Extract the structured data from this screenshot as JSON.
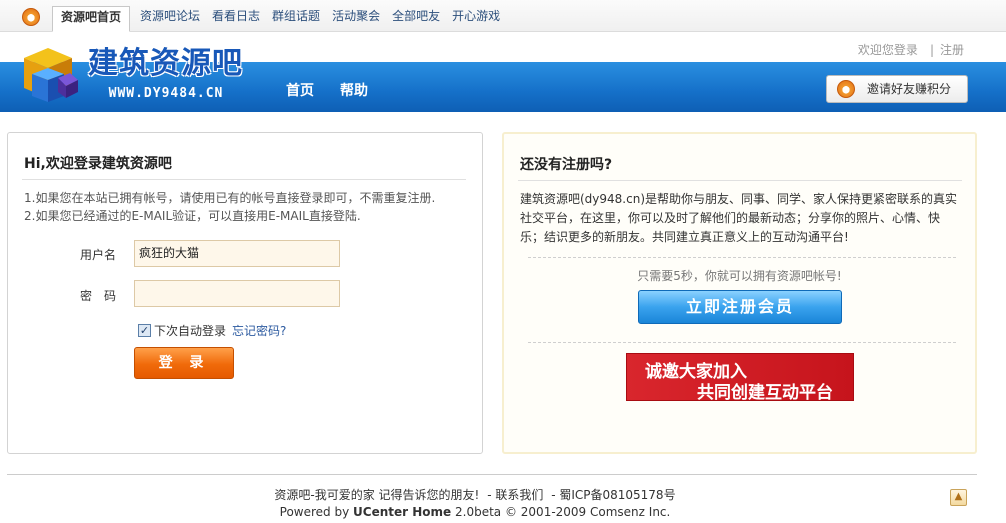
{
  "topnav": {
    "items": [
      {
        "label": "资源吧首页",
        "active": true
      },
      {
        "label": "资源吧论坛"
      },
      {
        "label": "看看日志"
      },
      {
        "label": "群组话题"
      },
      {
        "label": "活动聚会"
      },
      {
        "label": "全部吧友"
      },
      {
        "label": "开心游戏"
      }
    ]
  },
  "header": {
    "site_title": "建筑资源吧",
    "site_url": "WWW.DY9484.CN",
    "nav": [
      "首页",
      "帮助"
    ],
    "login_link": "欢迎您登录",
    "register_link": "注册",
    "separator": "|",
    "invite_label": "邀请好友赚积分"
  },
  "login": {
    "heading": "Hi,欢迎登录建筑资源吧",
    "tip1": "1.如果您在本站已拥有帐号，请使用已有的帐号直接登录即可，不需重复注册.",
    "tip2": "2.如果您已经通过的E-MAIL验证，可以直接用E-MAIL直接登陆.",
    "username_label": "用户名",
    "username_value": "疯狂的大猫",
    "password_label": "密　码",
    "remember_label": "下次自动登录",
    "remember_checked": true,
    "forgot_label": "忘记密码?",
    "submit_label": "登 录"
  },
  "register": {
    "heading": "还没有注册吗?",
    "description": "建筑资源吧(dy948.cn)是帮助你与朋友、同事、同学、家人保持更紧密联系的真实社交平台，在这里，你可以及时了解他们的最新动态；分享你的照片、心情、快乐；结识更多的新朋友。共同建立真正意义上的互动沟通平台!",
    "hint": "只需要5秒，你就可以拥有资源吧帐号!",
    "button_label": "立即注册会员",
    "banner_line1": "诚邀大家加入",
    "banner_line2": "共同创建互动平台"
  },
  "footer": {
    "slogan": "资源吧-我可爱的家 记得告诉您的朋友!",
    "contact": "- 联系我们",
    "icp": "- 蜀ICP备08105178号",
    "powered_prefix": "Powered by",
    "powered_name": "UCenter Home",
    "powered_version": "2.0beta © 2001-2009 Comsenz Inc."
  },
  "colors": {
    "header_blue": "#1570c9",
    "login_orange": "#f06a0a",
    "register_blue": "#3aa3ee",
    "banner_red": "#d9262d"
  }
}
